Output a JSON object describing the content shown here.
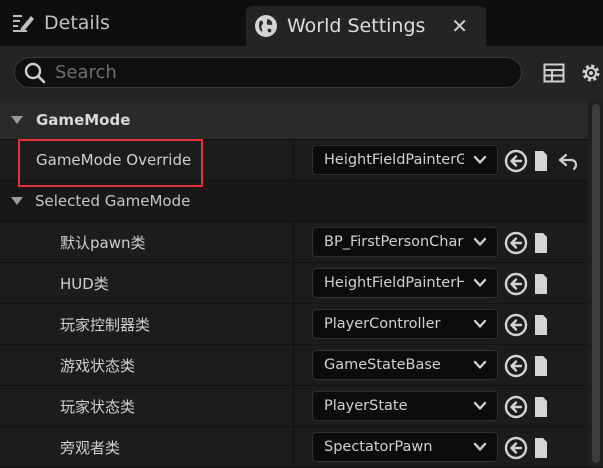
{
  "tabs": {
    "details": {
      "label": "Details",
      "icon": "edit-pencil-icon"
    },
    "world_settings": {
      "label": "World Settings",
      "icon": "globe-icon",
      "close_glyph": "✕"
    }
  },
  "search": {
    "placeholder": "Search",
    "value": ""
  },
  "toolbar": {
    "table_icon": "table-view-icon",
    "settings_icon": "gear-icon"
  },
  "category": {
    "label": "GameMode"
  },
  "gamemode_override": {
    "label": "GameMode Override",
    "value": "HeightFieldPainterGameMode",
    "highlighted": true,
    "highlight_color": "#e0343a"
  },
  "selected_gamemode": {
    "label": "Selected GameMode",
    "rows": [
      {
        "label": "默认pawn类",
        "value": "BP_FirstPersonCharacter"
      },
      {
        "label": "HUD类",
        "value": "HeightFieldPainterHUD"
      },
      {
        "label": "玩家控制器类",
        "value": "PlayerController"
      },
      {
        "label": "游戏状态类",
        "value": "GameStateBase"
      },
      {
        "label": "玩家状态类",
        "value": "PlayerState"
      },
      {
        "label": "旁观者类",
        "value": "SpectatorPawn"
      }
    ]
  },
  "colors": {
    "panel": "#242424",
    "highlight": "#e0343a"
  }
}
